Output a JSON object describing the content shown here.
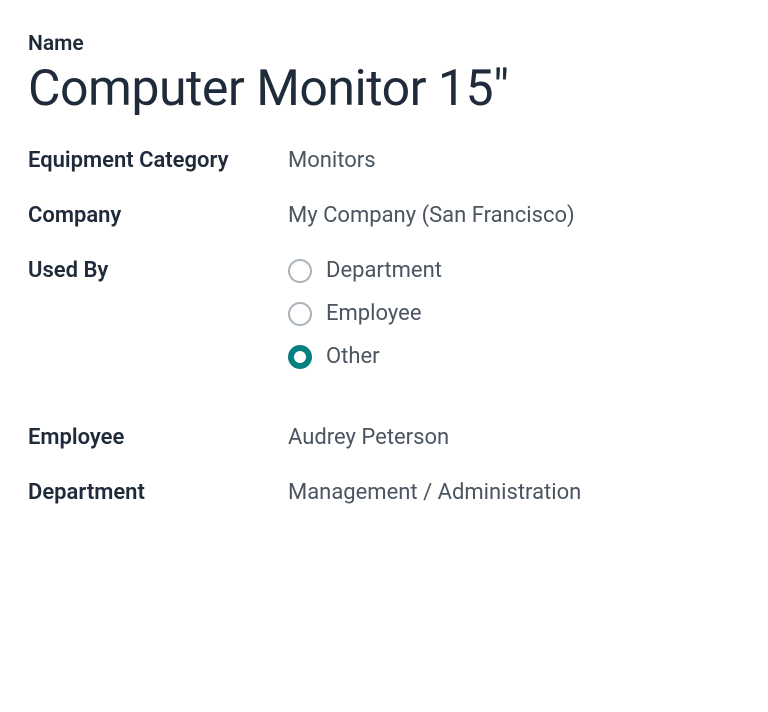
{
  "labels": {
    "name": "Name",
    "equipment_category": "Equipment Category",
    "company": "Company",
    "used_by": "Used By",
    "employee": "Employee",
    "department": "Department"
  },
  "values": {
    "name": "Computer Monitor 15\"",
    "equipment_category": "Monitors",
    "company": "My Company (San Francisco)",
    "employee": "Audrey Peterson",
    "department": "Management / Administration"
  },
  "used_by": {
    "options": [
      {
        "label": "Department",
        "selected": false
      },
      {
        "label": "Employee",
        "selected": false
      },
      {
        "label": "Other",
        "selected": true
      }
    ]
  }
}
